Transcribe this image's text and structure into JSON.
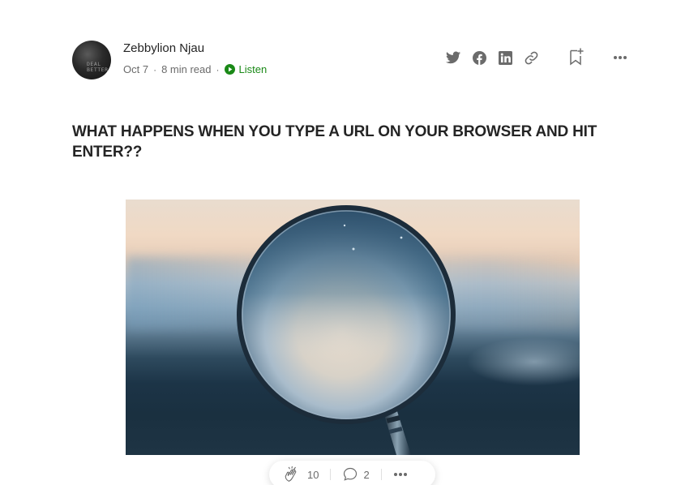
{
  "author": {
    "name": "Zebbylion Njau",
    "avatar_text": "DEAL\nBETTER",
    "date": "Oct 7",
    "read_time": "8 min read",
    "listen_label": "Listen",
    "separator": "·"
  },
  "actions": {
    "icons": [
      "twitter-icon",
      "facebook-icon",
      "linkedin-icon",
      "link-icon",
      "bookmark-add-icon",
      "more-icon"
    ]
  },
  "article": {
    "title": "WHAT HAPPENS WHEN YOU TYPE A URL ON YOUR BROWSER AND HIT ENTER??",
    "hero_image": "magnifying-glass-photo"
  },
  "clap_bar": {
    "clap_count": "10",
    "response_count": "2"
  },
  "colors": {
    "accent_green": "#1a8917",
    "text": "#242424",
    "muted": "#6b6b6b",
    "icon": "#6b6b6b"
  }
}
